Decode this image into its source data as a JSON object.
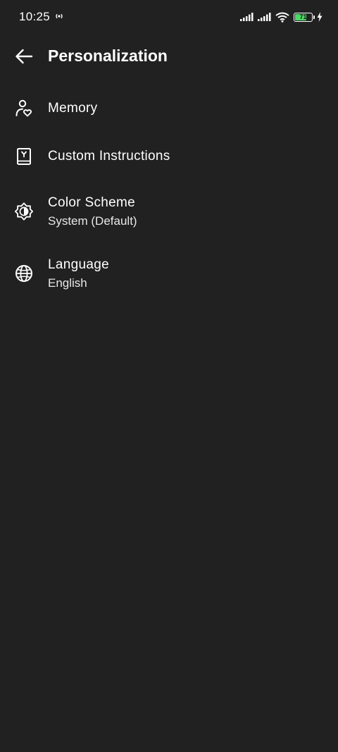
{
  "status_bar": {
    "time": "10:25",
    "battery_level": "71",
    "battery_fraction": 0.71,
    "icons": [
      "hotspot-icon",
      "cell-signal-icon",
      "cell-signal-icon",
      "wifi-icon",
      "battery-icon",
      "charging-icon"
    ]
  },
  "app_bar": {
    "title": "Personalization",
    "back_icon": "arrow-left-icon"
  },
  "settings": {
    "items": [
      {
        "title": "Memory",
        "icon": "memory-person-heart-icon"
      },
      {
        "title": "Custom Instructions",
        "icon": "instructions-book-icon"
      },
      {
        "title": "Color Scheme",
        "subtitle": "System (Default)",
        "icon": "brightness-icon"
      },
      {
        "title": "Language",
        "subtitle": "English",
        "icon": "globe-icon"
      }
    ]
  },
  "colors": {
    "background": "#212121",
    "text": "#ffffff",
    "battery": "#4cd964"
  }
}
